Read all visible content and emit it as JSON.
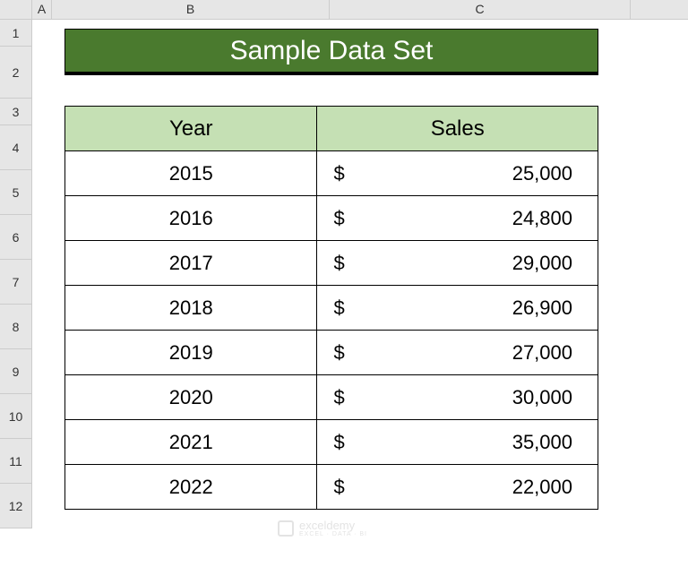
{
  "columns": [
    "A",
    "B",
    "C"
  ],
  "rows": [
    "1",
    "2",
    "3",
    "4",
    "5",
    "6",
    "7",
    "8",
    "9",
    "10",
    "11",
    "12"
  ],
  "title": "Sample Data Set",
  "headers": {
    "year": "Year",
    "sales": "Sales"
  },
  "currency": "$",
  "data": [
    {
      "year": "2015",
      "sales": "25,000"
    },
    {
      "year": "2016",
      "sales": "24,800"
    },
    {
      "year": "2017",
      "sales": "29,000"
    },
    {
      "year": "2018",
      "sales": "26,900"
    },
    {
      "year": "2019",
      "sales": "27,000"
    },
    {
      "year": "2020",
      "sales": "30,000"
    },
    {
      "year": "2021",
      "sales": "35,000"
    },
    {
      "year": "2022",
      "sales": "22,000"
    }
  ],
  "chart_data": {
    "type": "table",
    "title": "Sample Data Set",
    "columns": [
      "Year",
      "Sales"
    ],
    "rows": [
      [
        "2015",
        25000
      ],
      [
        "2016",
        24800
      ],
      [
        "2017",
        29000
      ],
      [
        "2018",
        26900
      ],
      [
        "2019",
        27000
      ],
      [
        "2020",
        30000
      ],
      [
        "2021",
        35000
      ],
      [
        "2022",
        22000
      ]
    ]
  },
  "watermark": {
    "brand": "exceldemy",
    "tagline": "EXCEL · DATA · BI"
  }
}
